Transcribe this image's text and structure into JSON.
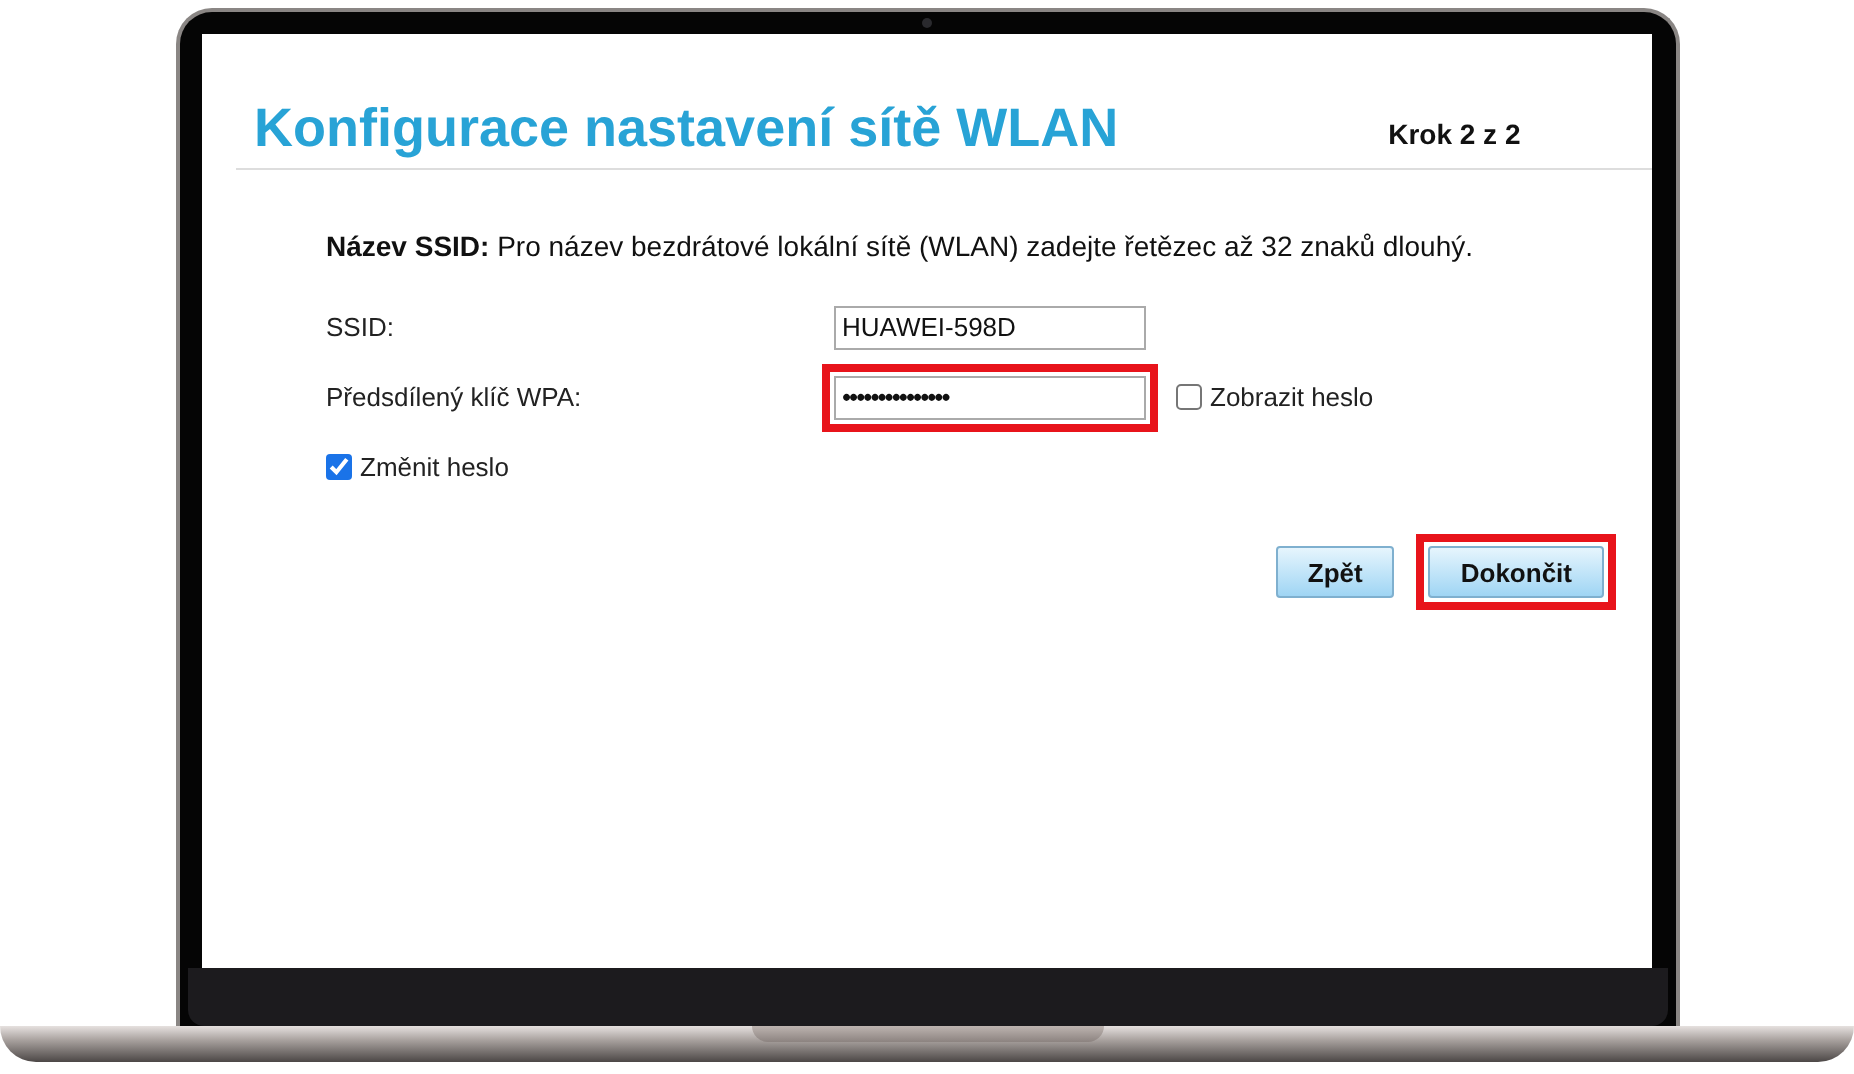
{
  "title": "Konfigurace nastavení sítě WLAN",
  "step": "Krok 2 z 2",
  "intro": "**Název SSID:** Pro název bezdrátové lokální sítě (WLAN) zadejte řetězec až 32 znaků dlouhý.",
  "fields": [
    {
      "kind": "text",
      "label": "SSID:",
      "value": "HUAWEI-598D",
      "highlighted": false
    },
    {
      "kind": "password",
      "label": "Předsdílený klíč WPA:",
      "value": "•••••••••••••••",
      "highlighted": true,
      "toggle": {
        "label": "Zobrazit heslo",
        "checked": false
      }
    }
  ],
  "change_password": {
    "label": "Změnit heslo",
    "checked": true
  },
  "buttons": [
    {
      "label": "Zpět",
      "highlighted": false
    },
    {
      "label": "Dokončit",
      "highlighted": true
    }
  ]
}
